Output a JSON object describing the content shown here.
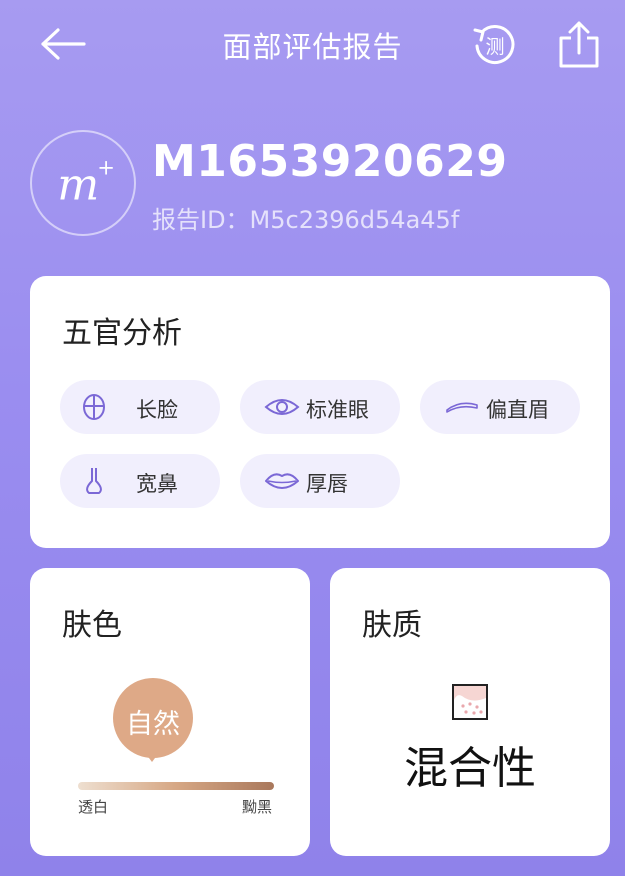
{
  "header": {
    "title": "面部评估报告",
    "retest_label": "测",
    "back_icon": "back-arrow-icon",
    "share_icon": "share-icon"
  },
  "profile": {
    "avatar_mark": "m",
    "avatar_plus": "+",
    "username": "M1653920629",
    "report_id": "报告ID：M5c2396d54a45f"
  },
  "features": {
    "title": "五官分析",
    "items": [
      {
        "label": "长脸",
        "icon": "face-shape-icon"
      },
      {
        "label": "标准眼",
        "icon": "eye-icon"
      },
      {
        "label": "偏直眉",
        "icon": "eyebrow-icon"
      },
      {
        "label": "宽鼻",
        "icon": "nose-icon"
      },
      {
        "label": "厚唇",
        "icon": "lips-icon"
      }
    ]
  },
  "skin_color": {
    "title": "肤色",
    "value": "自然",
    "scale_left": "透白",
    "scale_right": "黝黑"
  },
  "skin_type": {
    "title": "肤质",
    "value": "混合性",
    "icon": "skin-texture-icon"
  },
  "colors": {
    "background": "#9a8df0",
    "accent": "#7b68d6",
    "skin_tone": "#dea987"
  }
}
